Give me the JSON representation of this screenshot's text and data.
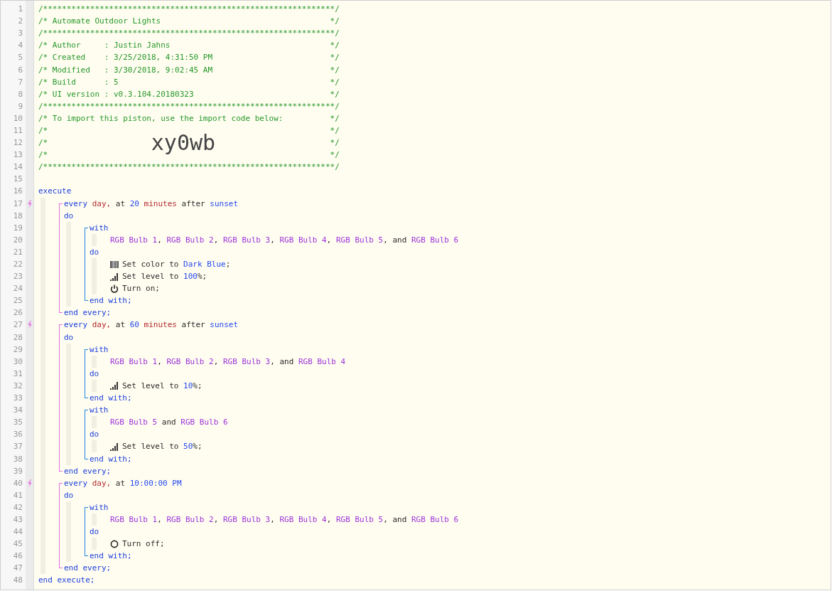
{
  "header": [
    {
      "number": "1",
      "kind": "rule",
      "text": "/**************************************************************/"
    },
    {
      "number": "2",
      "kind": "field",
      "left": "/* Automate Outdoor Lights",
      "right": "*/"
    },
    {
      "number": "3",
      "kind": "rule",
      "text": "/**************************************************************/"
    },
    {
      "number": "4",
      "kind": "field",
      "left": "/* Author     : Justin Jahns",
      "right": "*/"
    },
    {
      "number": "5",
      "kind": "field",
      "left": "/* Created    : 3/25/2018, 4:31:50 PM",
      "right": "*/"
    },
    {
      "number": "6",
      "kind": "field",
      "left": "/* Modified   : 3/30/2018, 9:02:45 AM",
      "right": "*/"
    },
    {
      "number": "7",
      "kind": "field",
      "left": "/* Build      : 5",
      "right": "*/"
    },
    {
      "number": "8",
      "kind": "field",
      "left": "/* UI version : v0.3.104.20180323",
      "right": "*/"
    },
    {
      "number": "9",
      "kind": "rule",
      "text": "/**************************************************************/"
    },
    {
      "number": "10",
      "kind": "field",
      "left": "/* To import this piston, use the import code below:",
      "right": "*/"
    },
    {
      "number": "11",
      "kind": "field",
      "left": "/*",
      "right": "*/"
    },
    {
      "number": "12",
      "kind": "code",
      "left": "/*",
      "code": "xy0wb",
      "right": "*/"
    },
    {
      "number": "13",
      "kind": "field",
      "left": "/*",
      "right": "*/"
    },
    {
      "number": "14",
      "kind": "rule",
      "text": "/**************************************************************/"
    },
    {
      "number": "15",
      "kind": "blank"
    }
  ],
  "program": {
    "kind": "execute",
    "rows": [
      {
        "kind": "line",
        "number": "16",
        "tokens": [
          {
            "text": "execute",
            "kind": "keyword"
          }
        ]
      },
      {
        "kind": "indent",
        "rows": [
          {
            "kind": "every",
            "rows": [
              {
                "kind": "line",
                "number": "17",
                "trigger": true,
                "tokens": [
                  {
                    "text": "every ",
                    "kind": "keyword"
                  },
                  {
                    "text": "day,",
                    "kind": "unit"
                  },
                  {
                    "text": " at ",
                    "kind": "text"
                  },
                  {
                    "text": "20",
                    "kind": "number"
                  },
                  {
                    "text": " minutes",
                    "kind": "unit"
                  },
                  {
                    "text": " after ",
                    "kind": "text"
                  },
                  {
                    "text": "sunset",
                    "kind": "number"
                  }
                ]
              },
              {
                "kind": "line",
                "number": "18",
                "tokens": [
                  {
                    "text": "do",
                    "kind": "keyword"
                  }
                ]
              },
              {
                "kind": "indent",
                "rows": [
                  {
                    "kind": "with",
                    "rows": [
                      {
                        "kind": "line",
                        "number": "19",
                        "tokens": [
                          {
                            "text": "with",
                            "kind": "keyword"
                          }
                        ]
                      },
                      {
                        "kind": "indent",
                        "rows": [
                          {
                            "kind": "line",
                            "number": "20",
                            "tokens": [
                              {
                                "text": "RGB Bulb 1",
                                "kind": "device"
                              },
                              {
                                "text": ", ",
                                "kind": "text"
                              },
                              {
                                "text": "RGB Bulb 2",
                                "kind": "device"
                              },
                              {
                                "text": ", ",
                                "kind": "text"
                              },
                              {
                                "text": "RGB Bulb 3",
                                "kind": "device"
                              },
                              {
                                "text": ", ",
                                "kind": "text"
                              },
                              {
                                "text": "RGB Bulb 4",
                                "kind": "device"
                              },
                              {
                                "text": ", ",
                                "kind": "text"
                              },
                              {
                                "text": "RGB Bulb 5",
                                "kind": "device"
                              },
                              {
                                "text": ", and ",
                                "kind": "text"
                              },
                              {
                                "text": "RGB Bulb 6",
                                "kind": "device"
                              }
                            ]
                          }
                        ]
                      },
                      {
                        "kind": "line",
                        "number": "21",
                        "tokens": [
                          {
                            "text": "do",
                            "kind": "keyword"
                          }
                        ]
                      },
                      {
                        "kind": "indent",
                        "rows": [
                          {
                            "kind": "color",
                            "number": "22",
                            "tokens": [
                              {
                                "text": "Set color to ",
                                "kind": "text"
                              },
                              {
                                "text": "Dark Blue",
                                "kind": "number"
                              },
                              {
                                "text": ";",
                                "kind": "text"
                              }
                            ]
                          },
                          {
                            "kind": "level",
                            "number": "23",
                            "tokens": [
                              {
                                "text": "Set level to ",
                                "kind": "text"
                              },
                              {
                                "text": "100",
                                "kind": "number"
                              },
                              {
                                "text": "%;",
                                "kind": "text"
                              }
                            ]
                          },
                          {
                            "kind": "on",
                            "number": "24",
                            "tokens": [
                              {
                                "text": "Turn on;",
                                "kind": "text"
                              }
                            ]
                          }
                        ]
                      },
                      {
                        "kind": "line",
                        "number": "25",
                        "tokens": [
                          {
                            "text": "end with;",
                            "kind": "keyword"
                          }
                        ]
                      }
                    ]
                  }
                ]
              },
              {
                "kind": "line",
                "number": "26",
                "tokens": [
                  {
                    "text": "end every;",
                    "kind": "keyword"
                  }
                ]
              }
            ]
          },
          {
            "kind": "every",
            "rows": [
              {
                "kind": "line",
                "number": "27",
                "trigger": true,
                "tokens": [
                  {
                    "text": "every ",
                    "kind": "keyword"
                  },
                  {
                    "text": "day,",
                    "kind": "unit"
                  },
                  {
                    "text": " at ",
                    "kind": "text"
                  },
                  {
                    "text": "60",
                    "kind": "number"
                  },
                  {
                    "text": " minutes",
                    "kind": "unit"
                  },
                  {
                    "text": " after ",
                    "kind": "text"
                  },
                  {
                    "text": "sunset",
                    "kind": "number"
                  }
                ]
              },
              {
                "kind": "line",
                "number": "28",
                "tokens": [
                  {
                    "text": "do",
                    "kind": "keyword"
                  }
                ]
              },
              {
                "kind": "indent",
                "rows": [
                  {
                    "kind": "with",
                    "rows": [
                      {
                        "kind": "line",
                        "number": "29",
                        "tokens": [
                          {
                            "text": "with",
                            "kind": "keyword"
                          }
                        ]
                      },
                      {
                        "kind": "indent",
                        "rows": [
                          {
                            "kind": "line",
                            "number": "30",
                            "tokens": [
                              {
                                "text": "RGB Bulb 1",
                                "kind": "device"
                              },
                              {
                                "text": ", ",
                                "kind": "text"
                              },
                              {
                                "text": "RGB Bulb 2",
                                "kind": "device"
                              },
                              {
                                "text": ", ",
                                "kind": "text"
                              },
                              {
                                "text": "RGB Bulb 3",
                                "kind": "device"
                              },
                              {
                                "text": ", and ",
                                "kind": "text"
                              },
                              {
                                "text": "RGB Bulb 4",
                                "kind": "device"
                              }
                            ]
                          }
                        ]
                      },
                      {
                        "kind": "line",
                        "number": "31",
                        "tokens": [
                          {
                            "text": "do",
                            "kind": "keyword"
                          }
                        ]
                      },
                      {
                        "kind": "indent",
                        "rows": [
                          {
                            "kind": "level",
                            "number": "32",
                            "tokens": [
                              {
                                "text": "Set level to ",
                                "kind": "text"
                              },
                              {
                                "text": "10",
                                "kind": "number"
                              },
                              {
                                "text": "%;",
                                "kind": "text"
                              }
                            ]
                          }
                        ]
                      },
                      {
                        "kind": "line",
                        "number": "33",
                        "tokens": [
                          {
                            "text": "end with;",
                            "kind": "keyword"
                          }
                        ]
                      }
                    ]
                  },
                  {
                    "kind": "with",
                    "rows": [
                      {
                        "kind": "line",
                        "number": "34",
                        "tokens": [
                          {
                            "text": "with",
                            "kind": "keyword"
                          }
                        ]
                      },
                      {
                        "kind": "indent",
                        "rows": [
                          {
                            "kind": "line",
                            "number": "35",
                            "tokens": [
                              {
                                "text": "RGB Bulb 5",
                                "kind": "device"
                              },
                              {
                                "text": " and ",
                                "kind": "text"
                              },
                              {
                                "text": "RGB Bulb 6",
                                "kind": "device"
                              }
                            ]
                          }
                        ]
                      },
                      {
                        "kind": "line",
                        "number": "36",
                        "tokens": [
                          {
                            "text": "do",
                            "kind": "keyword"
                          }
                        ]
                      },
                      {
                        "kind": "indent",
                        "rows": [
                          {
                            "kind": "level",
                            "number": "37",
                            "tokens": [
                              {
                                "text": "Set level to ",
                                "kind": "text"
                              },
                              {
                                "text": "50",
                                "kind": "number"
                              },
                              {
                                "text": "%;",
                                "kind": "text"
                              }
                            ]
                          }
                        ]
                      },
                      {
                        "kind": "line",
                        "number": "38",
                        "tokens": [
                          {
                            "text": "end with;",
                            "kind": "keyword"
                          }
                        ]
                      }
                    ]
                  }
                ]
              },
              {
                "kind": "line",
                "number": "39",
                "tokens": [
                  {
                    "text": "end every;",
                    "kind": "keyword"
                  }
                ]
              }
            ]
          },
          {
            "kind": "every",
            "rows": [
              {
                "kind": "line",
                "number": "40",
                "trigger": true,
                "tokens": [
                  {
                    "text": "every ",
                    "kind": "keyword"
                  },
                  {
                    "text": "day,",
                    "kind": "unit"
                  },
                  {
                    "text": " at ",
                    "kind": "text"
                  },
                  {
                    "text": "10:00:00 PM",
                    "kind": "number"
                  }
                ]
              },
              {
                "kind": "line",
                "number": "41",
                "tokens": [
                  {
                    "text": "do",
                    "kind": "keyword"
                  }
                ]
              },
              {
                "kind": "indent",
                "rows": [
                  {
                    "kind": "with",
                    "rows": [
                      {
                        "kind": "line",
                        "number": "42",
                        "tokens": [
                          {
                            "text": "with",
                            "kind": "keyword"
                          }
                        ]
                      },
                      {
                        "kind": "indent",
                        "rows": [
                          {
                            "kind": "line",
                            "number": "43",
                            "tokens": [
                              {
                                "text": "RGB Bulb 1",
                                "kind": "device"
                              },
                              {
                                "text": ", ",
                                "kind": "text"
                              },
                              {
                                "text": "RGB Bulb 2",
                                "kind": "device"
                              },
                              {
                                "text": ", ",
                                "kind": "text"
                              },
                              {
                                "text": "RGB Bulb 3",
                                "kind": "device"
                              },
                              {
                                "text": ", ",
                                "kind": "text"
                              },
                              {
                                "text": "RGB Bulb 4",
                                "kind": "device"
                              },
                              {
                                "text": ", ",
                                "kind": "text"
                              },
                              {
                                "text": "RGB Bulb 5",
                                "kind": "device"
                              },
                              {
                                "text": ", and ",
                                "kind": "text"
                              },
                              {
                                "text": "RGB Bulb 6",
                                "kind": "device"
                              }
                            ]
                          }
                        ]
                      },
                      {
                        "kind": "line",
                        "number": "44",
                        "tokens": [
                          {
                            "text": "do",
                            "kind": "keyword"
                          }
                        ]
                      },
                      {
                        "kind": "indent",
                        "rows": [
                          {
                            "kind": "off",
                            "number": "45",
                            "tokens": [
                              {
                                "text": "Turn off;",
                                "kind": "text"
                              }
                            ]
                          }
                        ]
                      },
                      {
                        "kind": "line",
                        "number": "46",
                        "tokens": [
                          {
                            "text": "end with;",
                            "kind": "keyword"
                          }
                        ]
                      }
                    ]
                  }
                ]
              },
              {
                "kind": "line",
                "number": "47",
                "tokens": [
                  {
                    "text": "end every;",
                    "kind": "keyword"
                  }
                ]
              }
            ]
          }
        ]
      },
      {
        "kind": "line",
        "number": "48",
        "tokens": [
          {
            "text": "end execute;",
            "kind": "keyword"
          }
        ]
      }
    ]
  }
}
